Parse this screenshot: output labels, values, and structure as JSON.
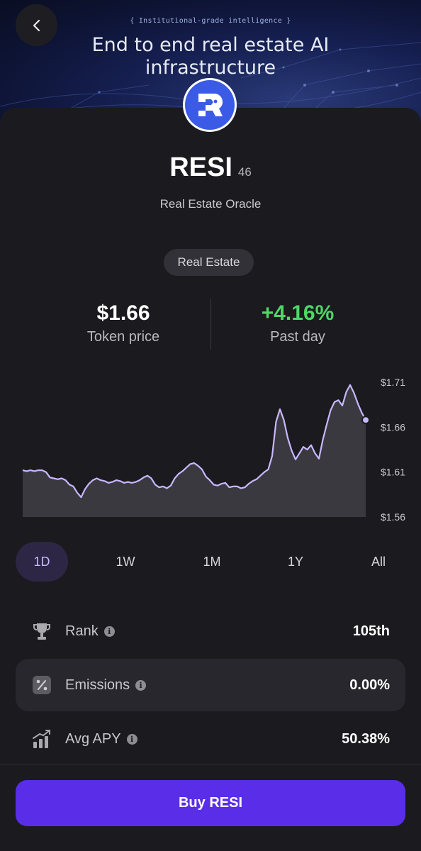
{
  "hero": {
    "tagline": "{ Institutional-grade intelligence }",
    "title_line1": "End to end real estate AI",
    "title_line2": "infrastructure"
  },
  "nav": {
    "back_icon": "chevron-left-icon"
  },
  "token": {
    "name": "RESI",
    "number": "46",
    "subtitle": "Real Estate Oracle",
    "category": "Real Estate",
    "logo_icon": "resi-logo-icon",
    "logo_color": "#3b5be6"
  },
  "stats": {
    "price_value": "$1.66",
    "price_label": "Token price",
    "change_value": "+4.16%",
    "change_label": "Past day",
    "change_color": "#4cd964"
  },
  "chart_data": {
    "type": "area",
    "y_tick_labels": [
      "$1.71",
      "$1.66",
      "$1.61",
      "$1.56"
    ],
    "y_ticks": [
      1.71,
      1.66,
      1.61,
      1.56
    ],
    "ylim": [
      1.56,
      1.71
    ],
    "line_color": "#c8b8ff",
    "fill_color": "#3a3940",
    "values": [
      1.612,
      1.611,
      1.612,
      1.611,
      1.612,
      1.612,
      1.61,
      1.604,
      1.603,
      1.602,
      1.603,
      1.601,
      1.596,
      1.594,
      1.587,
      1.582,
      1.591,
      1.597,
      1.601,
      1.603,
      1.601,
      1.6,
      1.598,
      1.599,
      1.601,
      1.6,
      1.598,
      1.599,
      1.598,
      1.599,
      1.601,
      1.604,
      1.606,
      1.603,
      1.596,
      1.593,
      1.594,
      1.592,
      1.595,
      1.603,
      1.608,
      1.611,
      1.615,
      1.619,
      1.62,
      1.617,
      1.613,
      1.605,
      1.601,
      1.596,
      1.595,
      1.597,
      1.598,
      1.593,
      1.594,
      1.594,
      1.592,
      1.593,
      1.597,
      1.6,
      1.602,
      1.606,
      1.61,
      1.613,
      1.628,
      1.666,
      1.68,
      1.668,
      1.648,
      1.634,
      1.624,
      1.631,
      1.638,
      1.635,
      1.64,
      1.631,
      1.625,
      1.646,
      1.663,
      1.679,
      1.688,
      1.69,
      1.684,
      1.699,
      1.707,
      1.698,
      1.686,
      1.676,
      1.668
    ]
  },
  "time_ranges": [
    {
      "label": "1D",
      "active": true
    },
    {
      "label": "1W",
      "active": false
    },
    {
      "label": "1M",
      "active": false
    },
    {
      "label": "1Y",
      "active": false
    },
    {
      "label": "All",
      "active": false
    }
  ],
  "metrics": [
    {
      "label": "Rank",
      "value": "105th",
      "icon": "trophy-icon",
      "info_icon": "info-icon",
      "highlight": false
    },
    {
      "label": "Emissions",
      "value": "0.00%",
      "icon": "percent-icon",
      "info_icon": "info-icon",
      "highlight": true
    },
    {
      "label": "Avg APY",
      "value": "50.38%",
      "icon": "bar-chart-growth-icon",
      "info_icon": "info-icon",
      "highlight": false
    }
  ],
  "buy_button": {
    "label": "Buy RESI",
    "color": "#5a2ee8"
  }
}
